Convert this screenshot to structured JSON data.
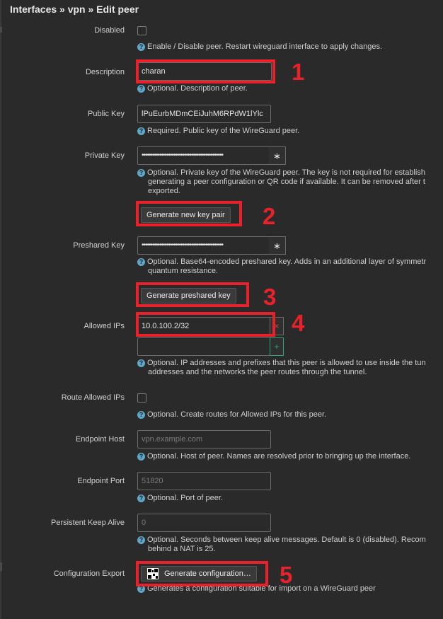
{
  "breadcrumb": "Interfaces » vpn » Edit peer",
  "fields": {
    "disabled": {
      "label": "Disabled",
      "help": "Enable / Disable peer. Restart wireguard interface to apply changes."
    },
    "description": {
      "label": "Description",
      "value": "charan",
      "help": "Optional. Description of peer."
    },
    "public_key": {
      "label": "Public Key",
      "value": "lPuEurbMDmCEiJuhM6RPdW1lYlc",
      "help": "Required. Public key of the WireGuard peer."
    },
    "private_key": {
      "label": "Private Key",
      "value": "••••••••••••••••••••••••••••••••••••••••••••••",
      "toggle": "∗",
      "help1": "Optional. Private key of the WireGuard peer. The key is not required for establish",
      "help2": "generating a peer configuration or QR code if available. It can be removed after t",
      "help3": "exported."
    },
    "generate_key_pair": {
      "label": "Generate new key pair"
    },
    "preshared_key": {
      "label": "Preshared Key",
      "value": "••••••••••••••••••••••••••••••••••••••••••••••",
      "toggle": "∗",
      "help1": "Optional. Base64-encoded preshared key. Adds in an additional layer of symmetr",
      "help2": "quantum resistance."
    },
    "generate_psk": {
      "label": "Generate preshared key"
    },
    "allowed_ips": {
      "label": "Allowed IPs",
      "value": "10.0.100.2/32",
      "remove": "×",
      "add": "+",
      "help1": "Optional. IP addresses and prefixes that this peer is allowed to use inside the tun",
      "help2": "addresses and the networks the peer routes through the tunnel."
    },
    "route_allowed_ips": {
      "label": "Route Allowed IPs",
      "help": "Optional. Create routes for Allowed IPs for this peer."
    },
    "endpoint_host": {
      "label": "Endpoint Host",
      "placeholder": "vpn.example.com",
      "help": "Optional. Host of peer. Names are resolved prior to bringing up the interface."
    },
    "endpoint_port": {
      "label": "Endpoint Port",
      "placeholder": "51820",
      "help": "Optional. Port of peer."
    },
    "keepalive": {
      "label": "Persistent Keep Alive",
      "placeholder": "0",
      "help1": "Optional. Seconds between keep alive messages. Default is 0 (disabled). Recom",
      "help2": "behind a NAT is 25."
    },
    "config_export": {
      "label": "Configuration Export",
      "button": "Generate configuration…",
      "help": "Generates a configuration suitable for import on a WireGuard peer"
    }
  },
  "annotations": [
    "1",
    "2",
    "3",
    "4",
    "5"
  ],
  "help_glyph": "?",
  "colors": {
    "background": "#2a2a2a",
    "highlight": "#e8212b",
    "help_icon": "#5fa7c9",
    "add_button": "#2aa77a",
    "remove_button": "#c9453a"
  }
}
